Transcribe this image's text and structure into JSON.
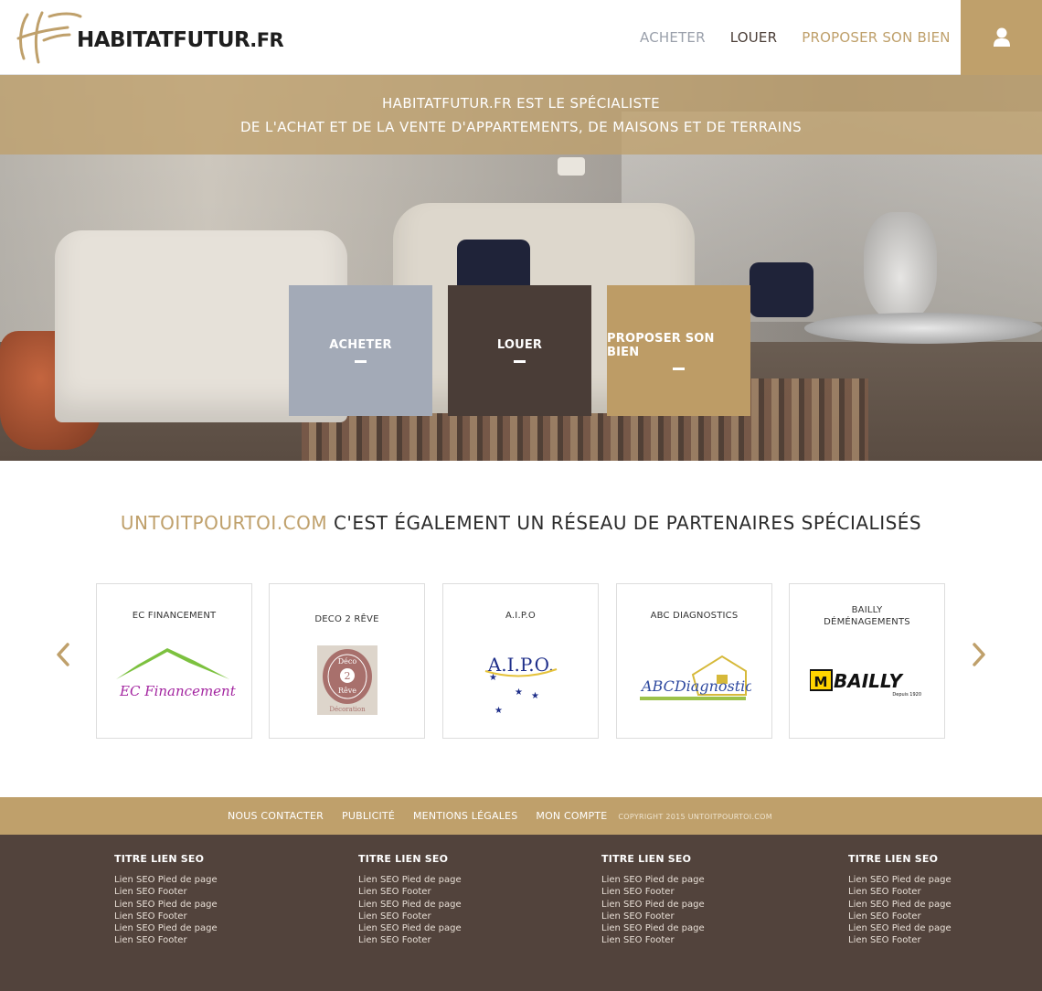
{
  "header": {
    "logo_text_main": "HABITATFUTUR",
    "logo_text_tld": ".FR",
    "nav": [
      "ACHETER",
      "LOUER",
      "PROPOSER SON BIEN"
    ],
    "account_icon": "user-icon"
  },
  "hero": {
    "line1": "HABITATFUTUR.FR EST LE SPÉCIALISTE",
    "line2": "DE L'ACHAT ET DE LA VENTE D'APPARTEMENTS, DE MAISONS ET DE TERRAINS",
    "tiles": [
      "ACHETER",
      "LOUER",
      "PROPOSER SON BIEN"
    ]
  },
  "partners": {
    "title_brand": "UNTOITPOURTOI.COM",
    "title_rest": " C'EST ÉGALEMENT UN RÉSEAU DE PARTENAIRES SPÉCIALISÉS",
    "items": [
      {
        "name": "EC FINANCEMENT",
        "logo_text": "EC Financement"
      },
      {
        "name": "DECO 2 RÊVE",
        "logo_top": "Déco",
        "logo_mid": "2",
        "logo_bottom": "Rêve",
        "logo_caption": "Décoration"
      },
      {
        "name": "A.I.P.O",
        "logo_text": "A.I.P.O."
      },
      {
        "name": "ABC DIAGNOSTICS",
        "logo_text": "ABCDiagnostics"
      },
      {
        "name": "BAILLY DÉMÉNAGEMENTS",
        "name_l1": "BAILLY",
        "name_l2": "DÉMÉNAGEMENTS",
        "logo_text": "BAILLY",
        "logo_sub": "Depuis 1920"
      }
    ]
  },
  "footer": {
    "links": [
      "NOUS CONTACTER",
      "PUBLICITÉ",
      "MENTIONS LÉGALES",
      "MON COMPTE"
    ],
    "copyright": "COPYRIGHT 2015 UNTOITPOURTOI.COM",
    "columns": [
      {
        "title": "TITRE LIEN SEO",
        "links": [
          "Lien SEO Pied de page",
          "Lien SEO Footer",
          "Lien SEO Pied de page",
          "Lien SEO Footer",
          "Lien SEO Pied de page",
          "Lien SEO Footer"
        ]
      },
      {
        "title": "TITRE LIEN SEO",
        "links": [
          "Lien SEO Pied de page",
          "Lien SEO Footer",
          "Lien SEO Pied de page",
          "Lien SEO Footer",
          "Lien SEO Pied de page",
          "Lien SEO Footer"
        ]
      },
      {
        "title": "TITRE LIEN SEO",
        "links": [
          "Lien SEO Pied de page",
          "Lien SEO Footer",
          "Lien SEO Pied de page",
          "Lien SEO Footer",
          "Lien SEO Pied de page",
          "Lien SEO Footer"
        ]
      },
      {
        "title": "TITRE LIEN SEO",
        "links": [
          "Lien SEO Pied de page",
          "Lien SEO Footer",
          "Lien SEO Pied de page",
          "Lien SEO Footer",
          "Lien SEO Pied de page",
          "Lien SEO Footer"
        ]
      }
    ]
  },
  "colors": {
    "gold": "#bfa06b",
    "dark_brown": "#52433c",
    "grey_blue": "#a3aab7"
  }
}
